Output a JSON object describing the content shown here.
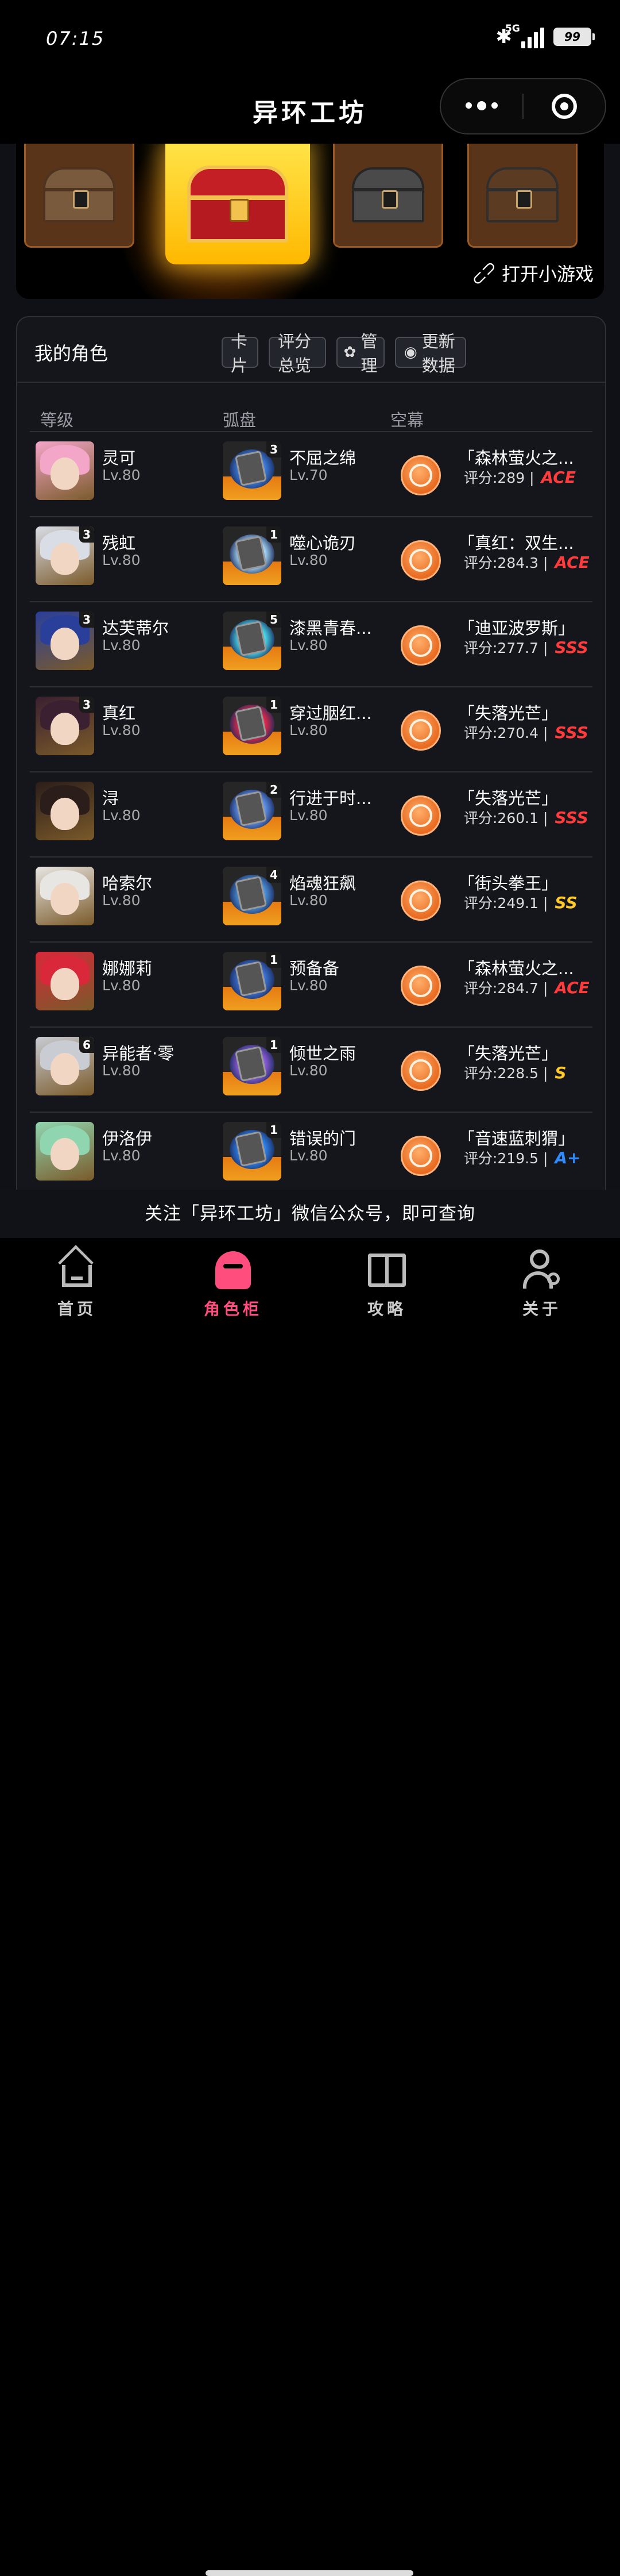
{
  "status_bar": {
    "time": "07:15",
    "network": "5G",
    "battery": "99"
  },
  "app": {
    "title": "异环工坊"
  },
  "banner": {
    "open_game_label": "打开小游戏"
  },
  "panel": {
    "title": "我的角色",
    "buttons": {
      "card": "卡片",
      "score_overview": "评分总览",
      "manage": "管理",
      "update": "更新数据"
    },
    "columns": {
      "level": "等级",
      "disc": "弧盘",
      "set": "空幕"
    }
  },
  "rows": [
    {
      "name": "灵可",
      "level": "Lv.80",
      "stars": "",
      "disc_name": "不屈之绵",
      "disc_level": "Lv.70",
      "disc_count": "3",
      "set_name": "「森林萤火之...",
      "score": "评分:289",
      "grade": "ACE",
      "grade_color": "#ff3b3b",
      "hair_color": "#f4a6c8",
      "disc_color": "#3a7ad8"
    },
    {
      "name": "残虹",
      "level": "Lv.80",
      "stars": "3",
      "disc_name": "噬心诡刃",
      "disc_level": "Lv.80",
      "disc_count": "1",
      "set_name": "「真红：双生...",
      "score": "评分:284.3",
      "grade": "ACE",
      "grade_color": "#ff3b3b",
      "hair_color": "#d9dde6",
      "disc_color": "#9fd0f0"
    },
    {
      "name": "达芙蒂尔",
      "level": "Lv.80",
      "stars": "3",
      "disc_name": "漆黑青春...",
      "disc_level": "Lv.80",
      "disc_count": "5",
      "set_name": "「迪亚波罗斯」",
      "score": "评分:277.7",
      "grade": "SSS",
      "grade_color": "#ff3b3b",
      "hair_color": "#2a3f9a",
      "disc_color": "#46d4e8"
    },
    {
      "name": "真红",
      "level": "Lv.80",
      "stars": "3",
      "disc_name": "穿过胭红...",
      "disc_level": "Lv.80",
      "disc_count": "1",
      "set_name": "「失落光芒」",
      "score": "评分:270.4",
      "grade": "SSS",
      "grade_color": "#ff3b3b",
      "hair_color": "#3a2030",
      "disc_color": "#e0284a"
    },
    {
      "name": "浔",
      "level": "Lv.80",
      "stars": "",
      "disc_name": "行进于时...",
      "disc_level": "Lv.80",
      "disc_count": "2",
      "set_name": "「失落光芒」",
      "score": "评分:260.1",
      "grade": "SSS",
      "grade_color": "#ff3b3b",
      "hair_color": "#2b1d1a",
      "disc_color": "#5b8ee8"
    },
    {
      "name": "哈索尔",
      "level": "Lv.80",
      "stars": "",
      "disc_name": "焰魂狂飙",
      "disc_level": "Lv.80",
      "disc_count": "4",
      "set_name": "「街头拳王」",
      "score": "评分:249.1",
      "grade": "SS",
      "grade_color": "#ffc928",
      "hair_color": "#e8e6e2",
      "disc_color": "#4a8fd8"
    },
    {
      "name": "娜娜莉",
      "level": "Lv.80",
      "stars": "",
      "disc_name": "预备备",
      "disc_level": "Lv.80",
      "disc_count": "1",
      "set_name": "「森林萤火之...",
      "score": "评分:284.7",
      "grade": "ACE",
      "grade_color": "#ff3b3b",
      "hair_color": "#d8283a",
      "disc_color": "#3a6fd0"
    },
    {
      "name": "异能者·零",
      "level": "Lv.80",
      "stars": "6",
      "disc_name": "倾世之雨",
      "disc_level": "Lv.80",
      "disc_count": "1",
      "set_name": "「失落光芒」",
      "score": "评分:228.5",
      "grade": "S",
      "grade_color": "#ffc928",
      "hair_color": "#c9ccd3",
      "disc_color": "#8a5ad8"
    },
    {
      "name": "伊洛伊",
      "level": "Lv.80",
      "stars": "",
      "disc_name": "错误的门",
      "disc_level": "Lv.80",
      "disc_count": "1",
      "set_name": "「音速蓝刺猬」",
      "score": "评分:219.5",
      "grade": "A+",
      "grade_color": "#2f8cff",
      "hair_color": "#8fd6b0",
      "disc_color": "#2d7fe8"
    }
  ],
  "notice": "关注「异环工坊」微信公众号，即可查询",
  "tabs": [
    {
      "label": "首页",
      "active": false
    },
    {
      "label": "角色柜",
      "active": true
    },
    {
      "label": "攻略",
      "active": false
    },
    {
      "label": "关于",
      "active": false
    }
  ],
  "colors": {
    "accent": "#ff4d7d",
    "tab_inactive": "#cccccc",
    "coin": "#e86a20"
  }
}
